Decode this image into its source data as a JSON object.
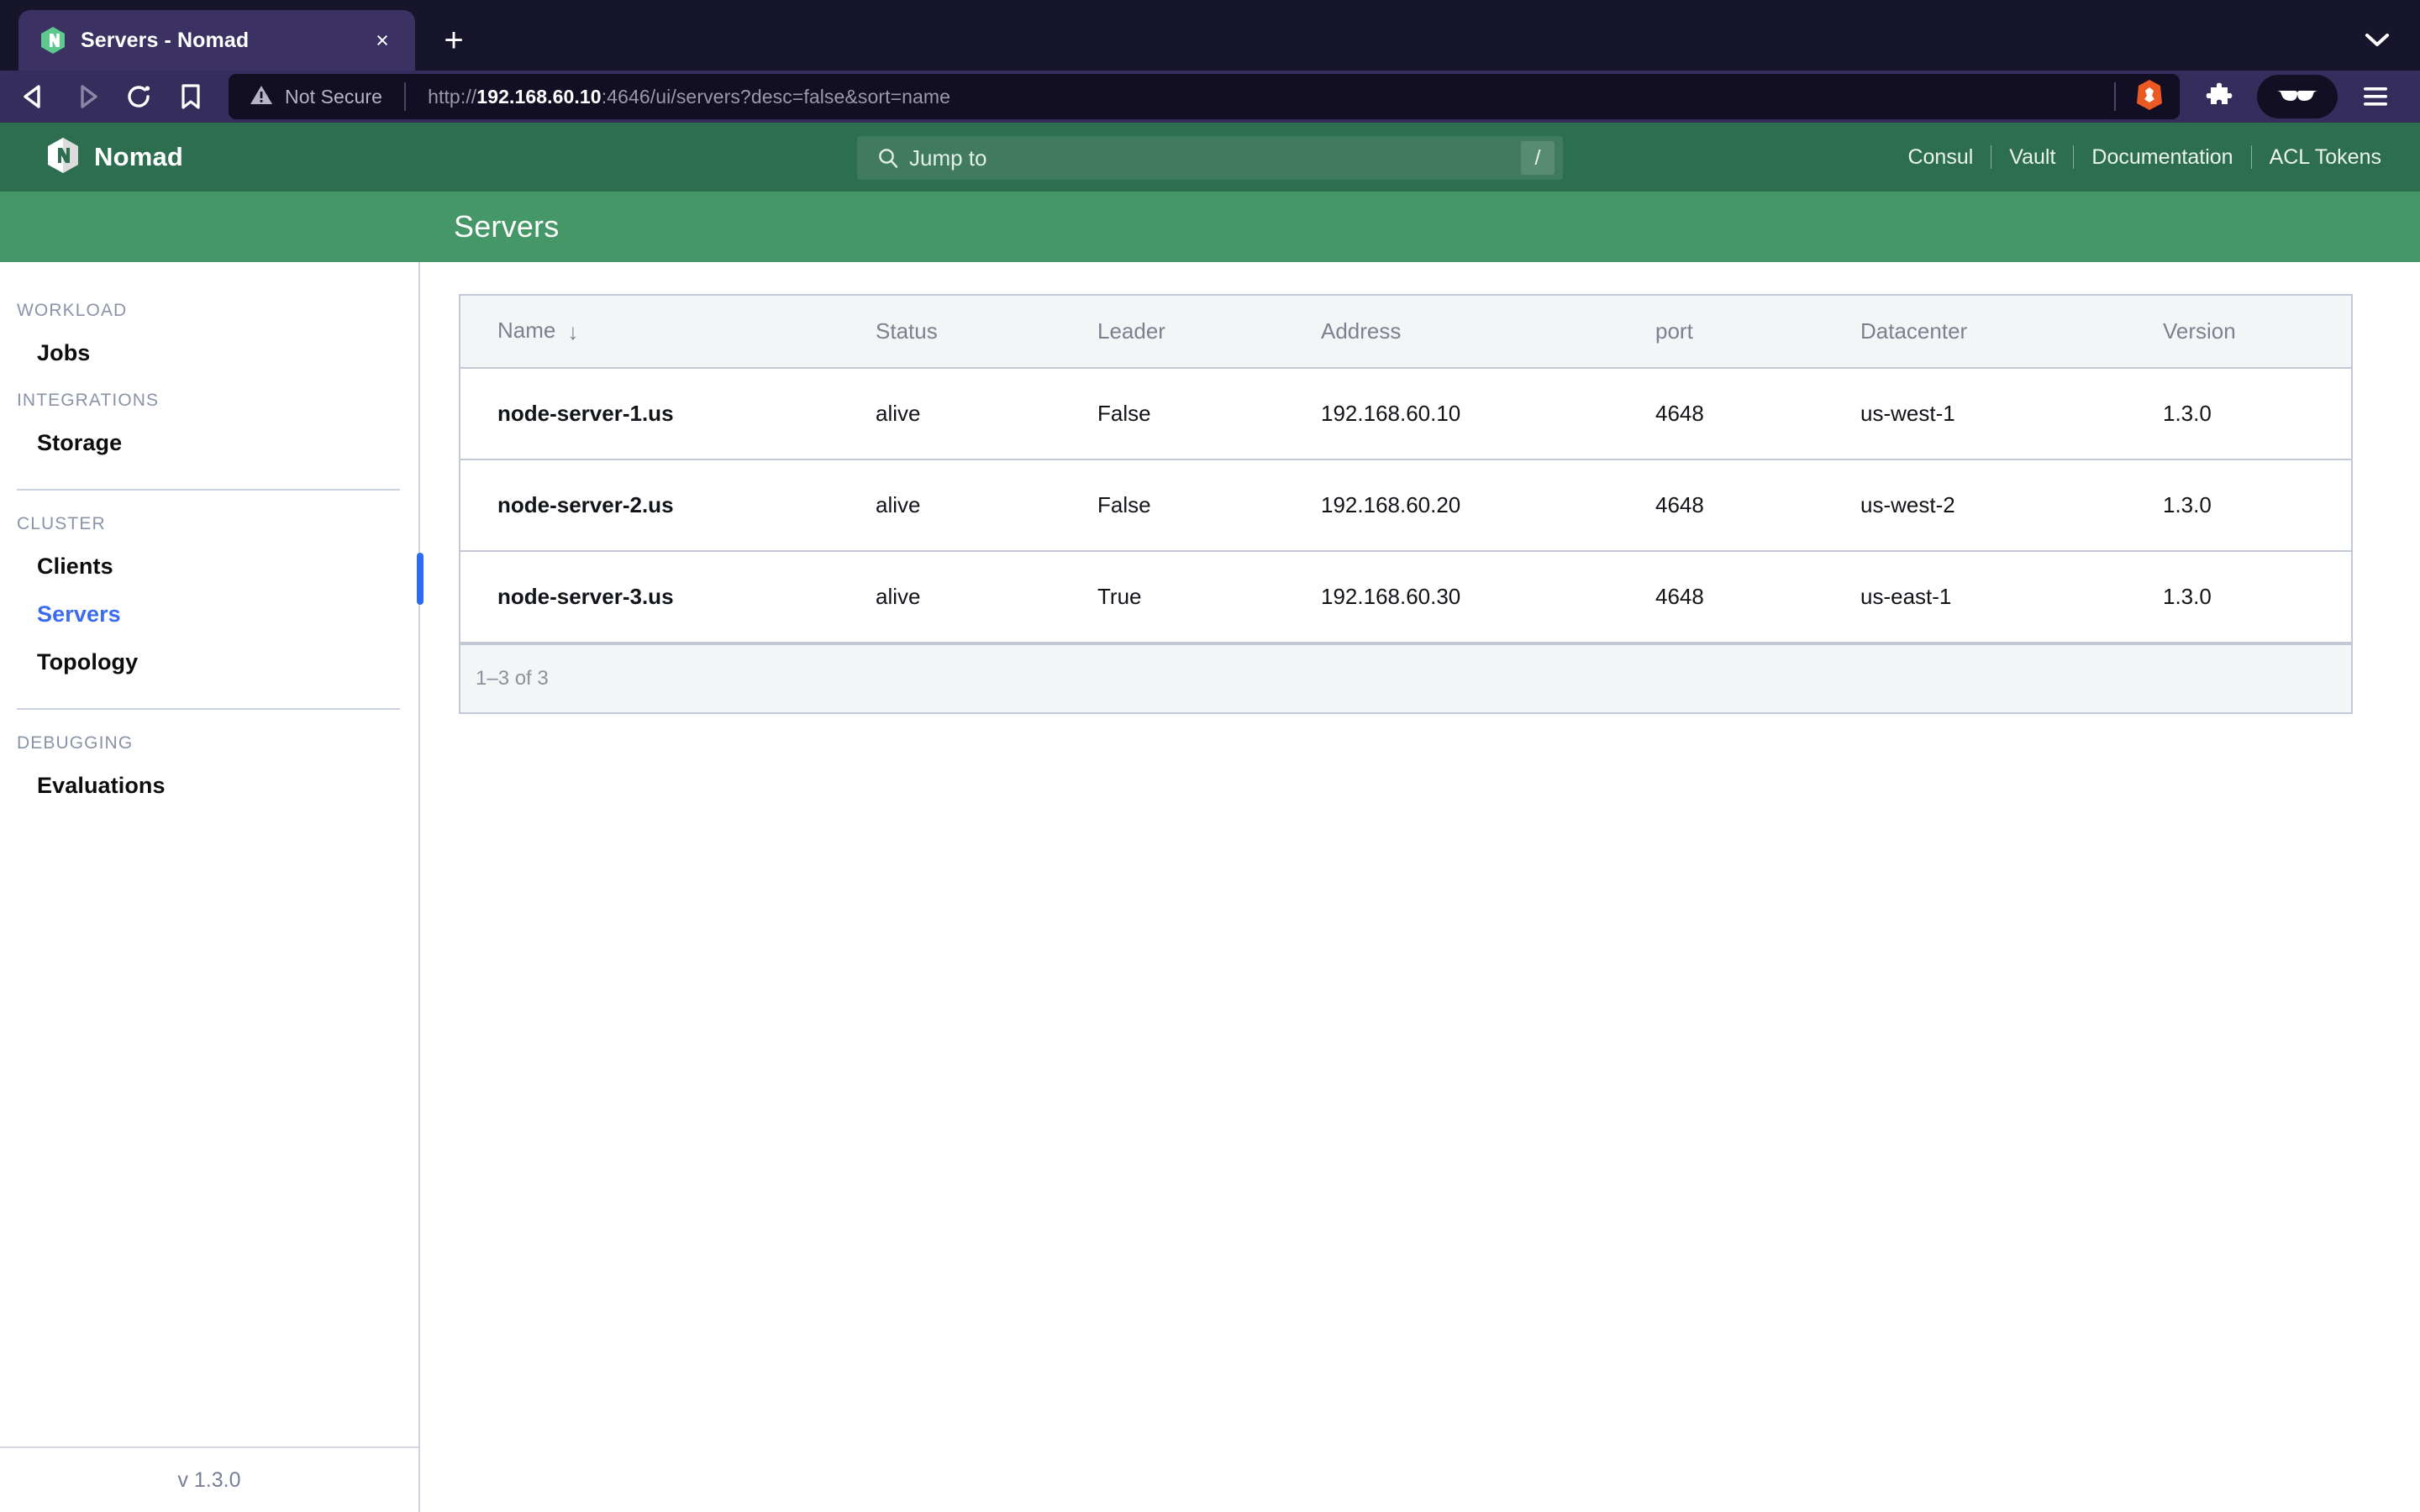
{
  "browser": {
    "tab": {
      "title": "Servers - Nomad",
      "favicon": "nomad-hexagon-icon",
      "close_label": "×"
    },
    "new_tab_label": "+",
    "toolbar": {
      "back_icon": "back-arrow-icon",
      "forward_icon": "forward-arrow-icon",
      "reload_icon": "reload-icon",
      "bookmark_icon": "bookmark-icon",
      "extensions_icon": "puzzle-piece-icon",
      "shields_icon": "brave-shields-icon",
      "menu_icon": "hamburger-menu-icon",
      "brave_lion_icon": "brave-lion-icon",
      "tab_search_icon": "chevron-down-icon"
    },
    "omnibox": {
      "security_label": "Not Secure",
      "security_icon": "warning-triangle-icon",
      "url_scheme": "http://",
      "url_host": "192.168.60.10",
      "url_rest": ":4646/ui/servers?desc=false&sort=name",
      "url_full": "http://192.168.60.10:4646/ui/servers?desc=false&sort=name"
    }
  },
  "app": {
    "brand": "Nomad",
    "brand_icon": "nomad-logo-icon",
    "search": {
      "placeholder": "Jump to",
      "icon": "search-icon",
      "shortcut_key": "/"
    },
    "header_links": [
      "Consul",
      "Vault",
      "Documentation",
      "ACL Tokens"
    ],
    "page_title": "Servers",
    "version_footer": "v 1.3.0",
    "accent_green_dark": "#2e6e50",
    "accent_green_light": "#459768",
    "accent_blue": "#3b6bf0"
  },
  "sidebar": {
    "sections": [
      {
        "label": "WORKLOAD",
        "items": [
          {
            "label": "Jobs",
            "active": false
          }
        ]
      },
      {
        "label": "INTEGRATIONS",
        "items": [
          {
            "label": "Storage",
            "active": false
          }
        ]
      },
      {
        "label": "CLUSTER",
        "items": [
          {
            "label": "Clients",
            "active": false
          },
          {
            "label": "Servers",
            "active": true
          },
          {
            "label": "Topology",
            "active": false
          }
        ]
      },
      {
        "label": "DEBUGGING",
        "items": [
          {
            "label": "Evaluations",
            "active": false
          }
        ]
      }
    ]
  },
  "table": {
    "columns": [
      "Name",
      "Status",
      "Leader",
      "Address",
      "port",
      "Datacenter",
      "Version"
    ],
    "sort_column": "Name",
    "sort_direction": "desc",
    "sort_glyph": "↓",
    "rows": [
      {
        "name": "node-server-1.us",
        "status": "alive",
        "leader": "False",
        "address": "192.168.60.10",
        "port": "4648",
        "datacenter": "us-west-1",
        "version": "1.3.0"
      },
      {
        "name": "node-server-2.us",
        "status": "alive",
        "leader": "False",
        "address": "192.168.60.20",
        "port": "4648",
        "datacenter": "us-west-2",
        "version": "1.3.0"
      },
      {
        "name": "node-server-3.us",
        "status": "alive",
        "leader": "True",
        "address": "192.168.60.30",
        "port": "4648",
        "datacenter": "us-east-1",
        "version": "1.3.0"
      }
    ],
    "pagination": "1–3 of 3"
  }
}
